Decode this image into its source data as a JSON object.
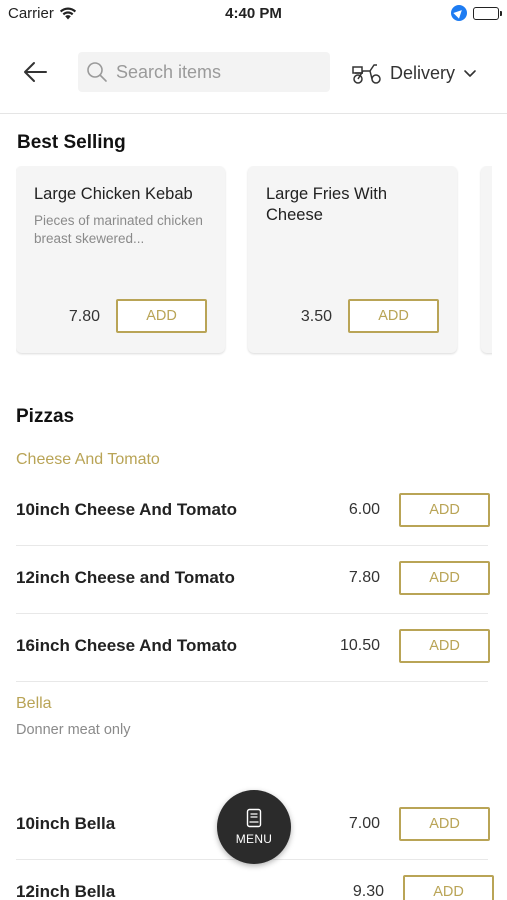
{
  "status_bar": {
    "carrier": "Carrier",
    "time": "4:40 PM"
  },
  "header": {
    "search_placeholder": "Search items",
    "delivery_label": "Delivery"
  },
  "best_selling": {
    "title": "Best Selling",
    "items": [
      {
        "name": "Large Chicken Kebab",
        "description": "Pieces of marinated chicken breast skewered...",
        "price": "7.80",
        "add_label": "ADD"
      },
      {
        "name": "Large Fries With Cheese",
        "description": "",
        "price": "3.50",
        "add_label": "ADD"
      }
    ]
  },
  "menu": {
    "category": "Pizzas",
    "groups": [
      {
        "name": "Cheese And Tomato",
        "description": "",
        "items": [
          {
            "name": "10inch Cheese And Tomato",
            "price": "6.00",
            "add_label": "ADD"
          },
          {
            "name": "12inch Cheese and Tomato",
            "price": "7.80",
            "add_label": "ADD"
          },
          {
            "name": "16inch Cheese And Tomato",
            "price": "10.50",
            "add_label": "ADD"
          }
        ]
      },
      {
        "name": "Bella",
        "description": "Donner meat only",
        "items": [
          {
            "name": "10inch Bella",
            "price": "7.00",
            "add_label": "ADD"
          },
          {
            "name": "12inch Bella",
            "price": "9.30",
            "add_label": "ADD"
          }
        ]
      }
    ]
  },
  "menu_button": {
    "label": "MENU"
  },
  "colors": {
    "accent": "#b9a456",
    "fab": "#2b2b2b",
    "location": "#1e7cf2"
  }
}
